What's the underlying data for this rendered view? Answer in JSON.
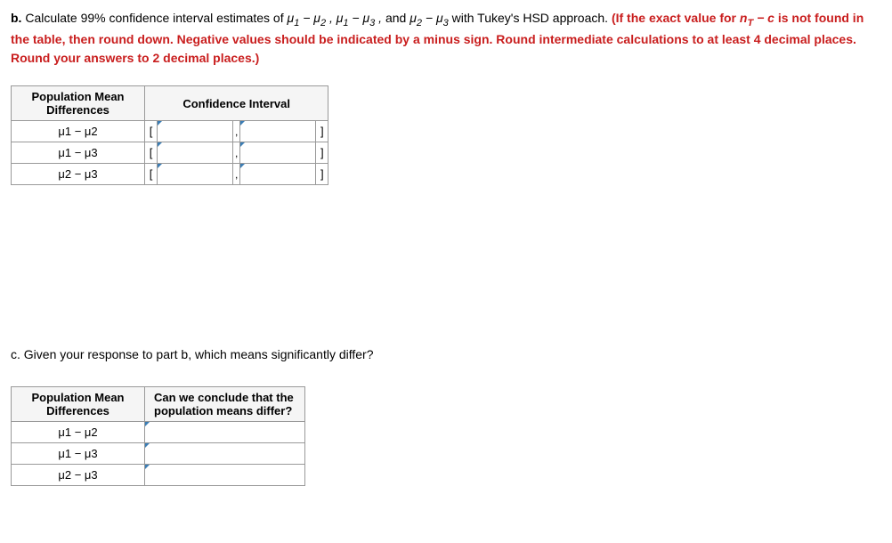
{
  "partB": {
    "label": "b.",
    "text1": "Calculate 99% confidence interval estimates of ",
    "mu1_mu2": "μ₁  −  μ₂ ,  μ₁ − μ₃ ,",
    "text2": " and ",
    "mu2_mu3": "μ₂  −  μ₃",
    "text3": " with Tukey's HSD approach. ",
    "redText": "(If the exact value for nT − c is not found in the table, then round down. Negative values should be indicated by a minus sign. Round intermediate calculations to at least 4 decimal places. Round your answers to 2 decimal places.)"
  },
  "tableB": {
    "header1": "Population Mean Differences",
    "header2": "Confidence Interval",
    "rows": [
      {
        "label": "μ1 − μ2",
        "lower": "",
        "upper": ""
      },
      {
        "label": "μ1 − μ3",
        "lower": "",
        "upper": ""
      },
      {
        "label": "μ2 − μ3",
        "lower": "",
        "upper": ""
      }
    ],
    "leftBracket": "[",
    "comma": ",",
    "rightBracket": "]"
  },
  "partC": {
    "label": "c.",
    "text": "Given your response to part b, which means significantly differ?"
  },
  "tableC": {
    "header1": "Population Mean Differences",
    "header2": "Can we conclude that the population means differ?",
    "rows": [
      {
        "label": "μ1 − μ2",
        "answer": ""
      },
      {
        "label": "μ1 − μ3",
        "answer": ""
      },
      {
        "label": "μ2 − μ3",
        "answer": ""
      }
    ]
  }
}
